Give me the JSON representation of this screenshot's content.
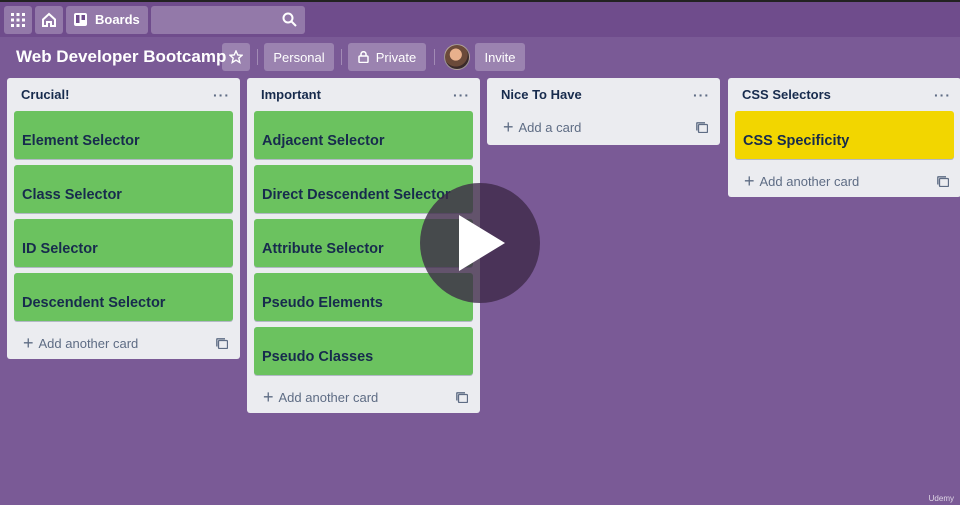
{
  "topbar": {
    "boards_label": "Boards"
  },
  "board": {
    "title": "Web Developer Bootcamp",
    "personal_label": "Personal",
    "private_label": "Private",
    "invite_label": "Invite"
  },
  "lists": [
    {
      "title": "Crucial!",
      "cards": [
        "Element Selector",
        "Class Selector",
        "ID Selector",
        "Descendent Selector"
      ],
      "add_label": "Add another card"
    },
    {
      "title": "Important",
      "cards": [
        "Adjacent Selector",
        "Direct Descendent Selector",
        "Attribute Selector",
        "Pseudo Elements",
        "Pseudo Classes"
      ],
      "add_label": "Add another card"
    },
    {
      "title": "Nice To Have",
      "cards": [],
      "add_label": "Add a card"
    },
    {
      "title": "CSS Selectors",
      "cards": [
        "CSS Specificity"
      ],
      "add_label": "Add another card"
    }
  ],
  "watermark": "Udemy",
  "colors": {
    "background": "#7a5a96",
    "green_label": "#6bc25f",
    "yellow_label": "#f2d600",
    "list_bg": "#ebecf0"
  },
  "icons": [
    "apps-grid-icon",
    "home-icon",
    "boards-icon",
    "search-icon",
    "star-icon",
    "lock-icon",
    "more-icon",
    "plus-icon",
    "card-template-icon",
    "play-icon"
  ]
}
